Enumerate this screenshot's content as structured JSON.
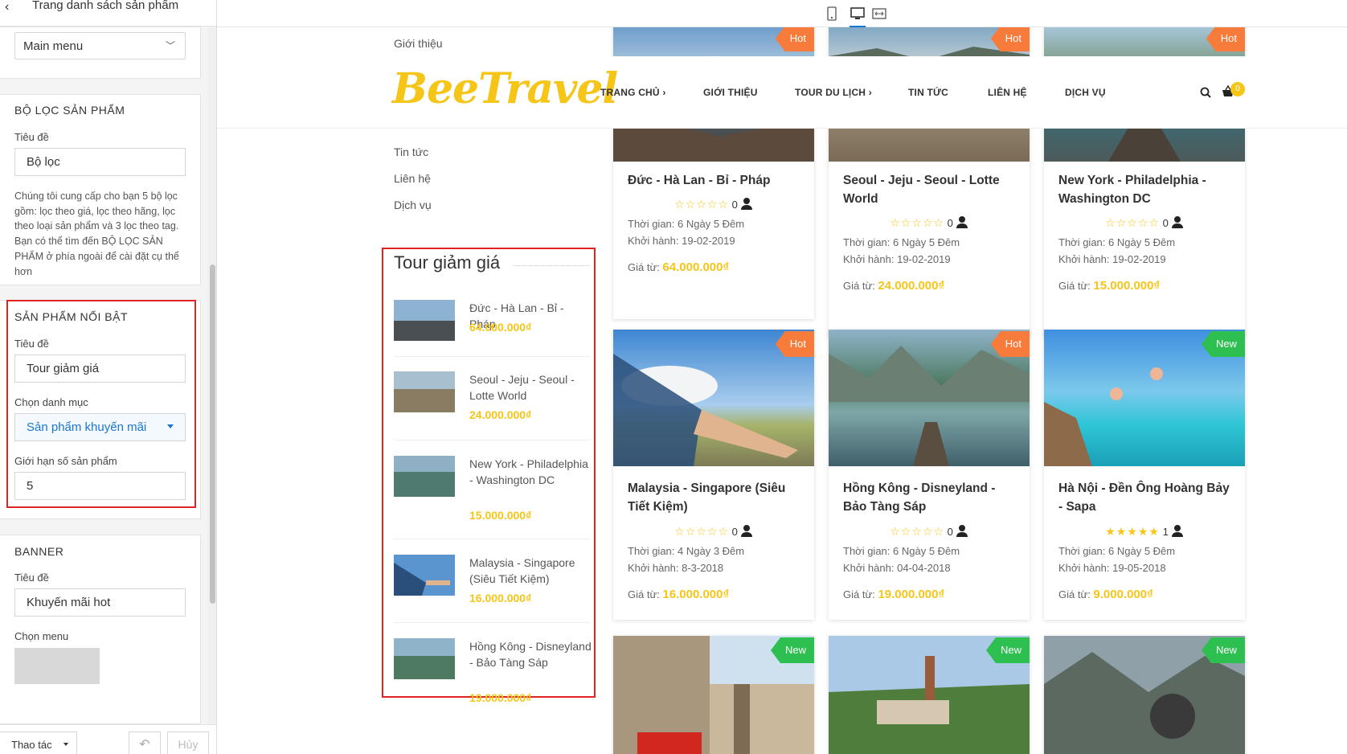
{
  "panel": {
    "title": "Trang danh sách sản phẩm",
    "menu_select": "Main menu",
    "filter_section": {
      "heading": "BỘ LỌC SẢN PHẨM",
      "title_label": "Tiêu đề",
      "title_value": "Bộ lọc",
      "description": "Chúng tôi cung cấp cho bạn 5 bộ lọc gồm: lọc theo giá, lọc theo hãng, lọc theo loại sản phẩm và 3 lọc theo tag. Bạn có thể tìm đến BỘ LỌC SẢN PHẨM ở phía ngoài để cài đặt cụ thể hơn"
    },
    "featured_section": {
      "heading": "SẢN PHẨM NỔI BẬT",
      "title_label": "Tiêu đề",
      "title_value": "Tour giảm giá",
      "category_label": "Chọn danh mục",
      "category_value": "Sản phẩm khuyến mãi",
      "limit_label": "Giới hạn số sản phẩm",
      "limit_value": "5"
    },
    "banner_section": {
      "heading": "BANNER",
      "title_label": "Tiêu đề",
      "title_value": "Khuyến mãi hot",
      "menu_label": "Chọn menu"
    },
    "actions_label": "Thao tác",
    "cancel_label": "Hủy"
  },
  "site": {
    "logo": "BeeTravel",
    "cart_count": "0",
    "nav": [
      {
        "label": "TRANG CHỦ",
        "arrow": "›"
      },
      {
        "label": "GIỚI THIỆU",
        "arrow": ""
      },
      {
        "label": "TOUR DU LỊCH",
        "arrow": "›"
      },
      {
        "label": "TIN TỨC",
        "arrow": ""
      },
      {
        "label": "LIÊN HỆ",
        "arrow": ""
      },
      {
        "label": "DỊCH VỤ",
        "arrow": ""
      }
    ],
    "sidebar_links": [
      "Giới thiệu",
      "Tin tức",
      "Liên hệ",
      "Dịch vụ"
    ],
    "widget": {
      "title": "Tour giảm giá",
      "items": [
        {
          "name": "Đức - Hà Lan - Bỉ - Pháp",
          "price": "64.000.000₫"
        },
        {
          "name": "Seoul - Jeju - Seoul - Lotte World",
          "price": "24.000.000₫"
        },
        {
          "name": "New York - Philadelphia - Washington DC",
          "price": "15.000.000₫"
        },
        {
          "name": "Malaysia - Singapore (Siêu Tiết Kiệm)",
          "price": "16.000.000₫"
        },
        {
          "name": "Hồng Kông - Disneyland - Bảo Tàng Sáp",
          "price": "19.000.000₫"
        }
      ]
    },
    "labels": {
      "time": "Thời gian:",
      "depart": "Khởi hành:",
      "from": "Giá từ:"
    },
    "tours": [
      {
        "badge": "Hot",
        "name": "Đức - Hà Lan - Bỉ - Pháp",
        "stars": "☆☆☆☆☆",
        "reviews": "0",
        "duration": "6 Ngày 5 Đêm",
        "departure": "19-02-2019",
        "price": "64.000.000₫"
      },
      {
        "badge": "Hot",
        "name": "Seoul - Jeju - Seoul - Lotte World",
        "stars": "☆☆☆☆☆",
        "reviews": "0",
        "duration": "6 Ngày 5 Đêm",
        "departure": "19-02-2019",
        "price": "24.000.000₫"
      },
      {
        "badge": "Hot",
        "name": "New York - Philadelphia - Washington DC",
        "stars": "☆☆☆☆☆",
        "reviews": "0",
        "duration": "6 Ngày 5 Đêm",
        "departure": "19-02-2019",
        "price": "15.000.000₫"
      },
      {
        "badge": "Hot",
        "name": "Malaysia - Singapore (Siêu Tiết Kiệm)",
        "stars": "☆☆☆☆☆",
        "reviews": "0",
        "duration": "4 Ngày 3 Đêm",
        "departure": "8-3-2018",
        "price": "16.000.000₫"
      },
      {
        "badge": "Hot",
        "name": "Hồng Kông - Disneyland - Bảo Tàng Sáp",
        "stars": "☆☆☆☆☆",
        "reviews": "0",
        "duration": "6 Ngày 5 Đêm",
        "departure": "04-04-2018",
        "price": "19.000.000₫"
      },
      {
        "badge": "New",
        "name": "Hà Nội - Đền Ông Hoàng Bảy - Sapa",
        "stars": "★★★★★",
        "reviews": "1",
        "duration": "6 Ngày 5 Đêm",
        "departure": "19-05-2018",
        "price": "9.000.000₫"
      },
      {
        "badge": "New"
      },
      {
        "badge": "New"
      },
      {
        "badge": "New"
      }
    ]
  }
}
